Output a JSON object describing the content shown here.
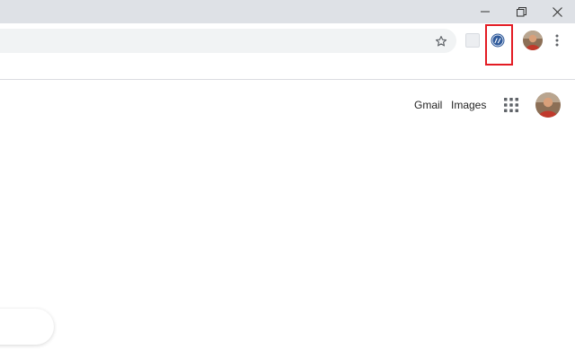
{
  "window": {
    "minimize_icon": "minimize-icon",
    "restore_icon": "restore-icon",
    "close_icon": "close-icon"
  },
  "toolbar": {
    "bookmark_icon": "star-icon",
    "extensions": [
      "puzzle-extension-icon",
      "ge-extension-icon"
    ],
    "highlight_color": "#e31b23",
    "menu_icon": "vertical-dots-icon"
  },
  "header": {
    "gmail_label": "Gmail",
    "images_label": "Images",
    "apps_icon": "apps-grid-icon"
  },
  "colors": {
    "titlebar": "#dee1e6",
    "omnibox": "#f1f3f4",
    "ge_badge": "#2f5a9b"
  }
}
